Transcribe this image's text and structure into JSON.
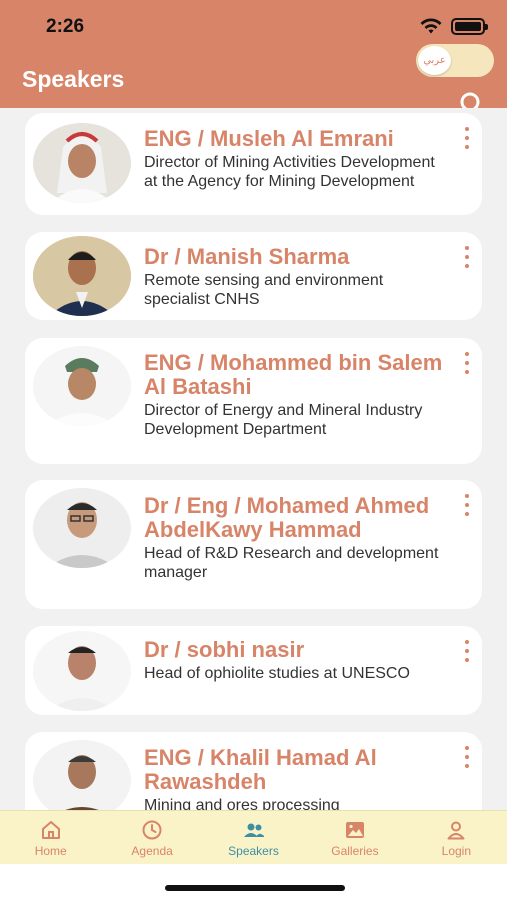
{
  "status_bar": {
    "time": "2:26"
  },
  "header": {
    "title": "Speakers",
    "lang_toggle_label": "عربي"
  },
  "speakers": [
    {
      "name": "ENG / Musleh Al Emrani",
      "role": "Director of Mining Activities Development at the Agency for Mining Development"
    },
    {
      "name": "Dr / Manish Sharma",
      "role": "Remote sensing and environment specialist CNHS"
    },
    {
      "name": "ENG / Mohammed bin Salem Al Batashi",
      "role": "Director of Energy and Mineral Industry Development Department"
    },
    {
      "name": "Dr / Eng / Mohamed Ahmed AbdelKawy Hammad",
      "role": "Head of R&D Research and development manager"
    },
    {
      "name": "Dr / sobhi nasir",
      "role": "Head of ophiolite studies at UNESCO"
    },
    {
      "name": "ENG /  Khalil Hamad Al Rawashdeh",
      "role": "Mining and ores processing"
    }
  ],
  "tabs": [
    {
      "label": "Home",
      "icon": "home-icon"
    },
    {
      "label": "Agenda",
      "icon": "clock-icon"
    },
    {
      "label": "Speakers",
      "icon": "people-icon",
      "active": true
    },
    {
      "label": "Galleries",
      "icon": "image-icon"
    },
    {
      "label": "Login",
      "icon": "person-icon"
    }
  ],
  "colors": {
    "accent": "#d78468",
    "active_tab": "#3c8fa3",
    "tabbar_bg": "#fbf3c8"
  }
}
